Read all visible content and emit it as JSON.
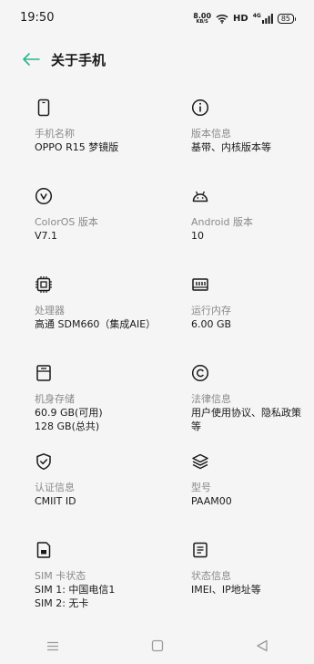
{
  "status": {
    "time": "19:50",
    "net_speed": "8.00",
    "net_unit": "KB/S",
    "hd": "HD",
    "battery": "85",
    "network_type": "4G"
  },
  "header": {
    "title": "关于手机"
  },
  "items": [
    {
      "label": "手机名称",
      "value1": "OPPO R15 梦镜版",
      "value2": "",
      "icon": "phone-icon"
    },
    {
      "label": "版本信息",
      "value1": "基带、内核版本等",
      "value2": "",
      "icon": "info-icon"
    },
    {
      "label": "ColorOS 版本",
      "value1": "V7.1",
      "value2": "",
      "icon": "coloros-icon"
    },
    {
      "label": "Android 版本",
      "value1": "10",
      "value2": "",
      "icon": "android-icon"
    },
    {
      "label": "处理器",
      "value1": "高通 SDM660（集成AIE）",
      "value2": "",
      "icon": "chip-icon"
    },
    {
      "label": "运行内存",
      "value1": "6.00 GB",
      "value2": "",
      "icon": "ram-icon"
    },
    {
      "label": "机身存储",
      "value1": "60.9 GB(可用)",
      "value2": "128 GB(总共)",
      "icon": "storage-icon"
    },
    {
      "label": "法律信息",
      "value1": "用户使用协议、隐私政策",
      "value2": "等",
      "icon": "copyright-icon"
    },
    {
      "label": "认证信息",
      "value1": "CMIIT ID",
      "value2": "",
      "icon": "shield-icon"
    },
    {
      "label": "型号",
      "value1": "PAAM00",
      "value2": "",
      "icon": "layers-icon"
    },
    {
      "label": "SIM 卡状态",
      "value1": "SIM 1: 中国电信1",
      "value2": "SIM 2: 无卡",
      "icon": "sim-card-icon"
    },
    {
      "label": "状态信息",
      "value1": "IMEI、IP地址等",
      "value2": "",
      "icon": "document-icon"
    }
  ],
  "colors": {
    "accent": "#2bb58d",
    "background": "#f5f5f5",
    "label": "#8a8a8a",
    "text": "#1a1a1a"
  }
}
